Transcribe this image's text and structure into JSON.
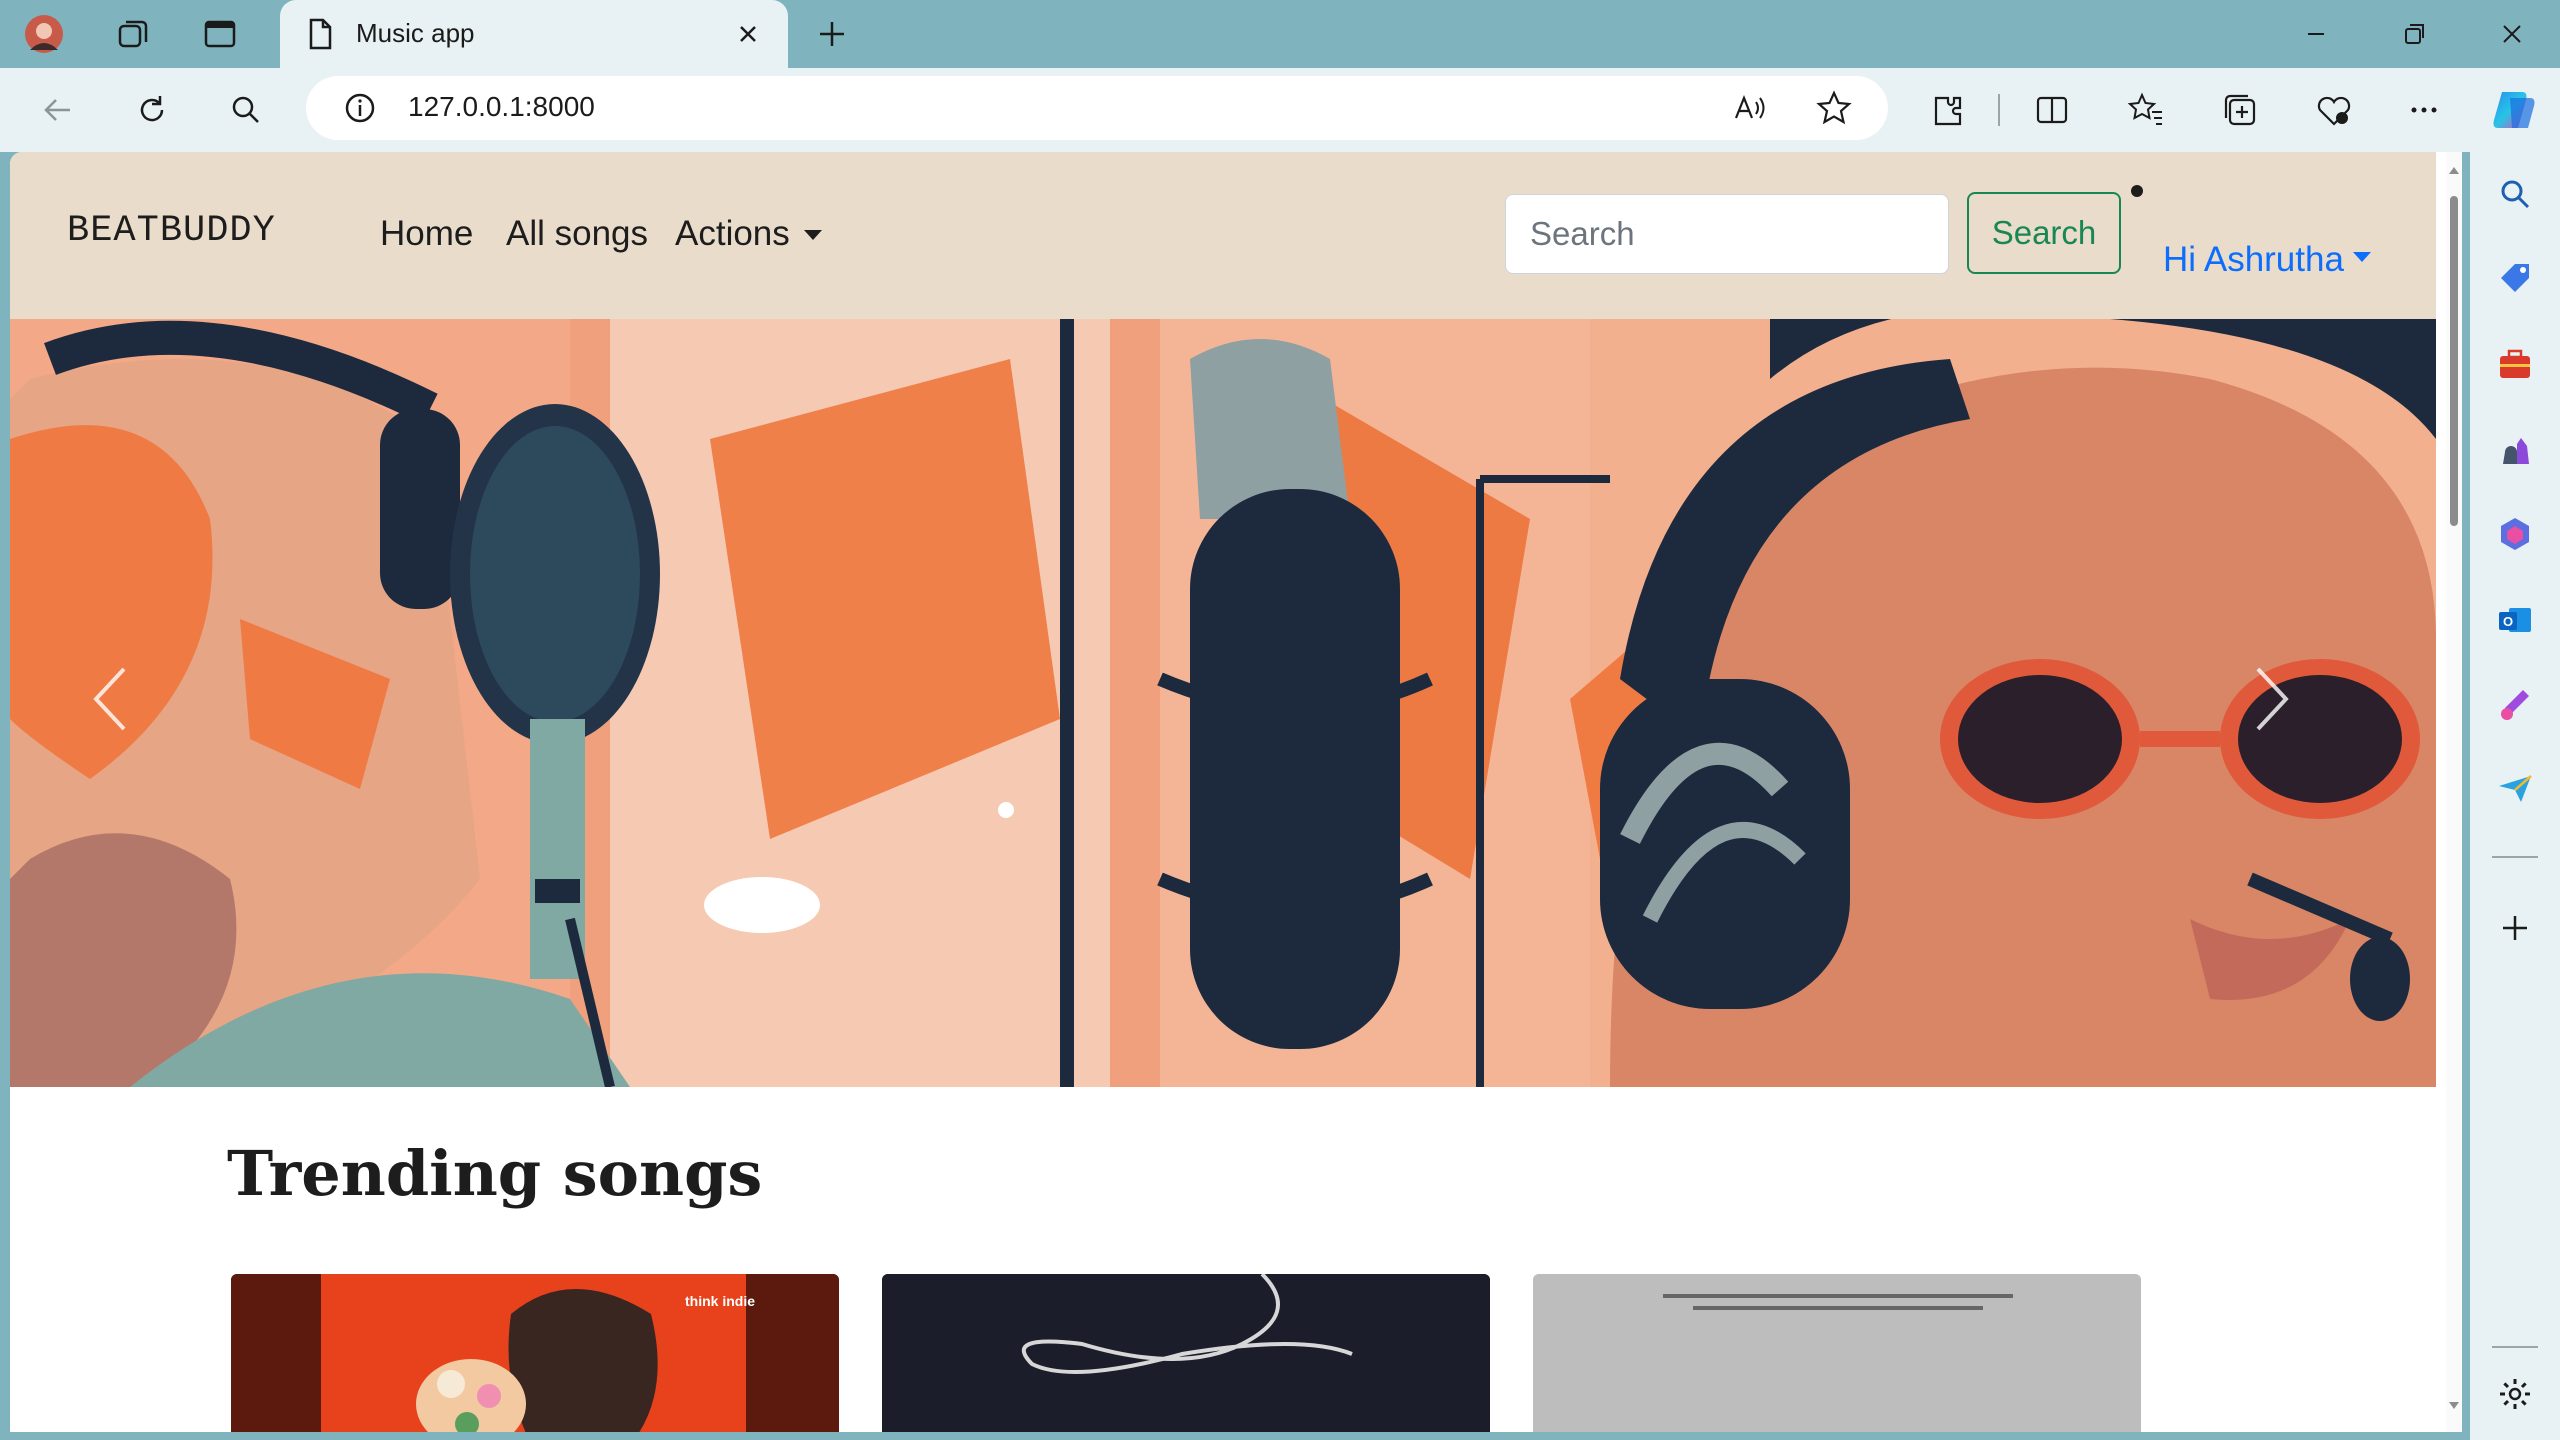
{
  "browser": {
    "tab_title": "Music app",
    "url": "127.0.0.1:8000"
  },
  "site": {
    "brand": "BEATBUDDY",
    "nav": {
      "home": "Home",
      "all_songs": "All songs",
      "actions": "Actions"
    },
    "search": {
      "placeholder": "Search",
      "button_label": "Search"
    },
    "user_greeting": "Hi Ashrutha",
    "section_title": "Trending songs",
    "cards": [
      {
        "tag": "think indie"
      },
      {
        "tag": ""
      },
      {
        "tag": ""
      }
    ]
  },
  "colors": {
    "navbar_bg": "#e9dccb",
    "accent_success": "#198754",
    "link_primary": "#0d6efd",
    "browser_frame": "#7fb4be"
  },
  "icons": {
    "titlebar": [
      "profile-avatar-icon",
      "workspaces-icon",
      "vertical-tabs-icon",
      "page-icon",
      "close-tab-icon",
      "new-tab-icon",
      "minimize-icon",
      "restore-icon",
      "close-window-icon"
    ],
    "toolbar": [
      "back-icon",
      "refresh-icon",
      "search-icon",
      "site-info-icon",
      "read-aloud-icon",
      "favorite-star-icon",
      "extensions-icon",
      "split-screen-icon",
      "favorites-icon",
      "collections-icon",
      "browser-essentials-icon",
      "more-icon",
      "copilot-icon"
    ],
    "sidebar": [
      "sidebar-search-icon",
      "shopping-tag-icon",
      "tools-briefcase-icon",
      "games-chess-icon",
      "m365-icon",
      "outlook-icon",
      "designer-icon",
      "send-icon",
      "sidebar-add-icon",
      "sidebar-settings-icon"
    ]
  }
}
